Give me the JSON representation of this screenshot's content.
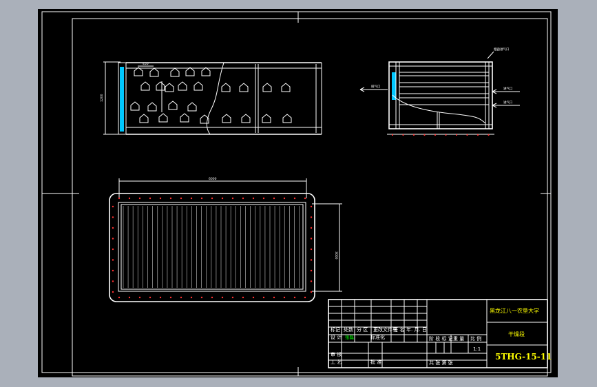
{
  "colors": {
    "background": "#aab0ba",
    "canvas": "#000000",
    "line": "#ffffff",
    "title_text": "#ffff00",
    "accent_text": "#00ff00",
    "fluid": "#00c8ff",
    "bolt": "#ff3030"
  },
  "plan_view": {
    "dim_left": "1200",
    "dim_top": "450"
  },
  "elevation_view": {
    "outlet_label": "排气口",
    "inlet_top_label": "进气口",
    "inlet_bottom_label": "进气口",
    "top_note": "烟囱进气口"
  },
  "bottom_view": {
    "dim_width": "6000",
    "dim_height": "3000"
  },
  "title_block": {
    "university": "黑龙江八一农垦大学",
    "drawing_name": "干燥段",
    "drawing_number": "5THG-15-11",
    "scale": "1:1",
    "row_mark": "标记",
    "row_count": "处数",
    "row_zone": "分 区",
    "row_docno": "更改文件号",
    "row_sign": "签 名",
    "row_date": "年. 月. 日",
    "design": "设 计",
    "designer": "张磊",
    "std": "标准化",
    "stage": "阶 段 标 记",
    "weight": "重 量",
    "scale_label": "比 例",
    "review": "审 核",
    "process": "工 艺",
    "approve": "批 准",
    "sheets": "共    张    第    张"
  }
}
